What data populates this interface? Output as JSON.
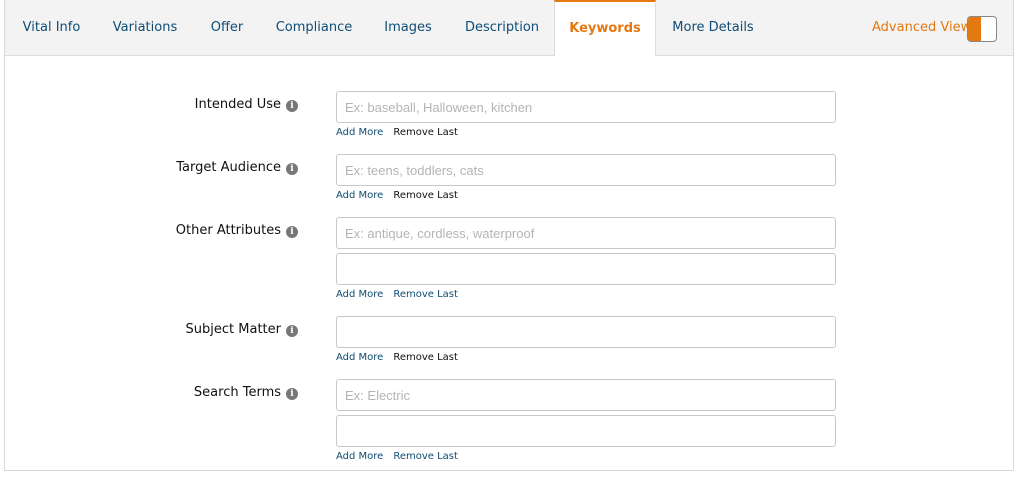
{
  "tabs": [
    {
      "label": "Vital Info"
    },
    {
      "label": "Variations"
    },
    {
      "label": "Offer"
    },
    {
      "label": "Compliance"
    },
    {
      "label": "Images"
    },
    {
      "label": "Description"
    },
    {
      "label": "Keywords",
      "active": true
    },
    {
      "label": "More Details"
    }
  ],
  "advanced_view": {
    "label": "Advanced View",
    "on": true
  },
  "colors": {
    "accent": "#e47911",
    "link": "#0f4d74",
    "tab_bg": "#f3f3f3"
  },
  "fields": {
    "intended_use": {
      "label": "Intended Use",
      "inputs": [
        {
          "value": "",
          "placeholder": "Ex: baseball, Halloween, kitchen"
        }
      ],
      "add_more": "Add More",
      "remove_last": "Remove Last"
    },
    "target_audience": {
      "label": "Target Audience",
      "inputs": [
        {
          "value": "",
          "placeholder": "Ex: teens, toddlers, cats"
        }
      ],
      "add_more": "Add More",
      "remove_last": "Remove Last"
    },
    "other_attributes": {
      "label": "Other Attributes",
      "inputs": [
        {
          "value": "",
          "placeholder": "Ex: antique, cordless, waterproof"
        },
        {
          "value": "",
          "placeholder": ""
        }
      ],
      "add_more": "Add More",
      "remove_last": "Remove Last"
    },
    "subject_matter": {
      "label": "Subject Matter",
      "inputs": [
        {
          "value": "",
          "placeholder": ""
        }
      ],
      "add_more": "Add More",
      "remove_last": "Remove Last"
    },
    "search_terms": {
      "label": "Search Terms",
      "inputs": [
        {
          "value": "",
          "placeholder": "Ex: Electric"
        },
        {
          "value": "",
          "placeholder": ""
        }
      ],
      "add_more": "Add More",
      "remove_last": "Remove Last"
    }
  },
  "info_icon": {
    "glyph": "i",
    "name": "info-icon"
  }
}
